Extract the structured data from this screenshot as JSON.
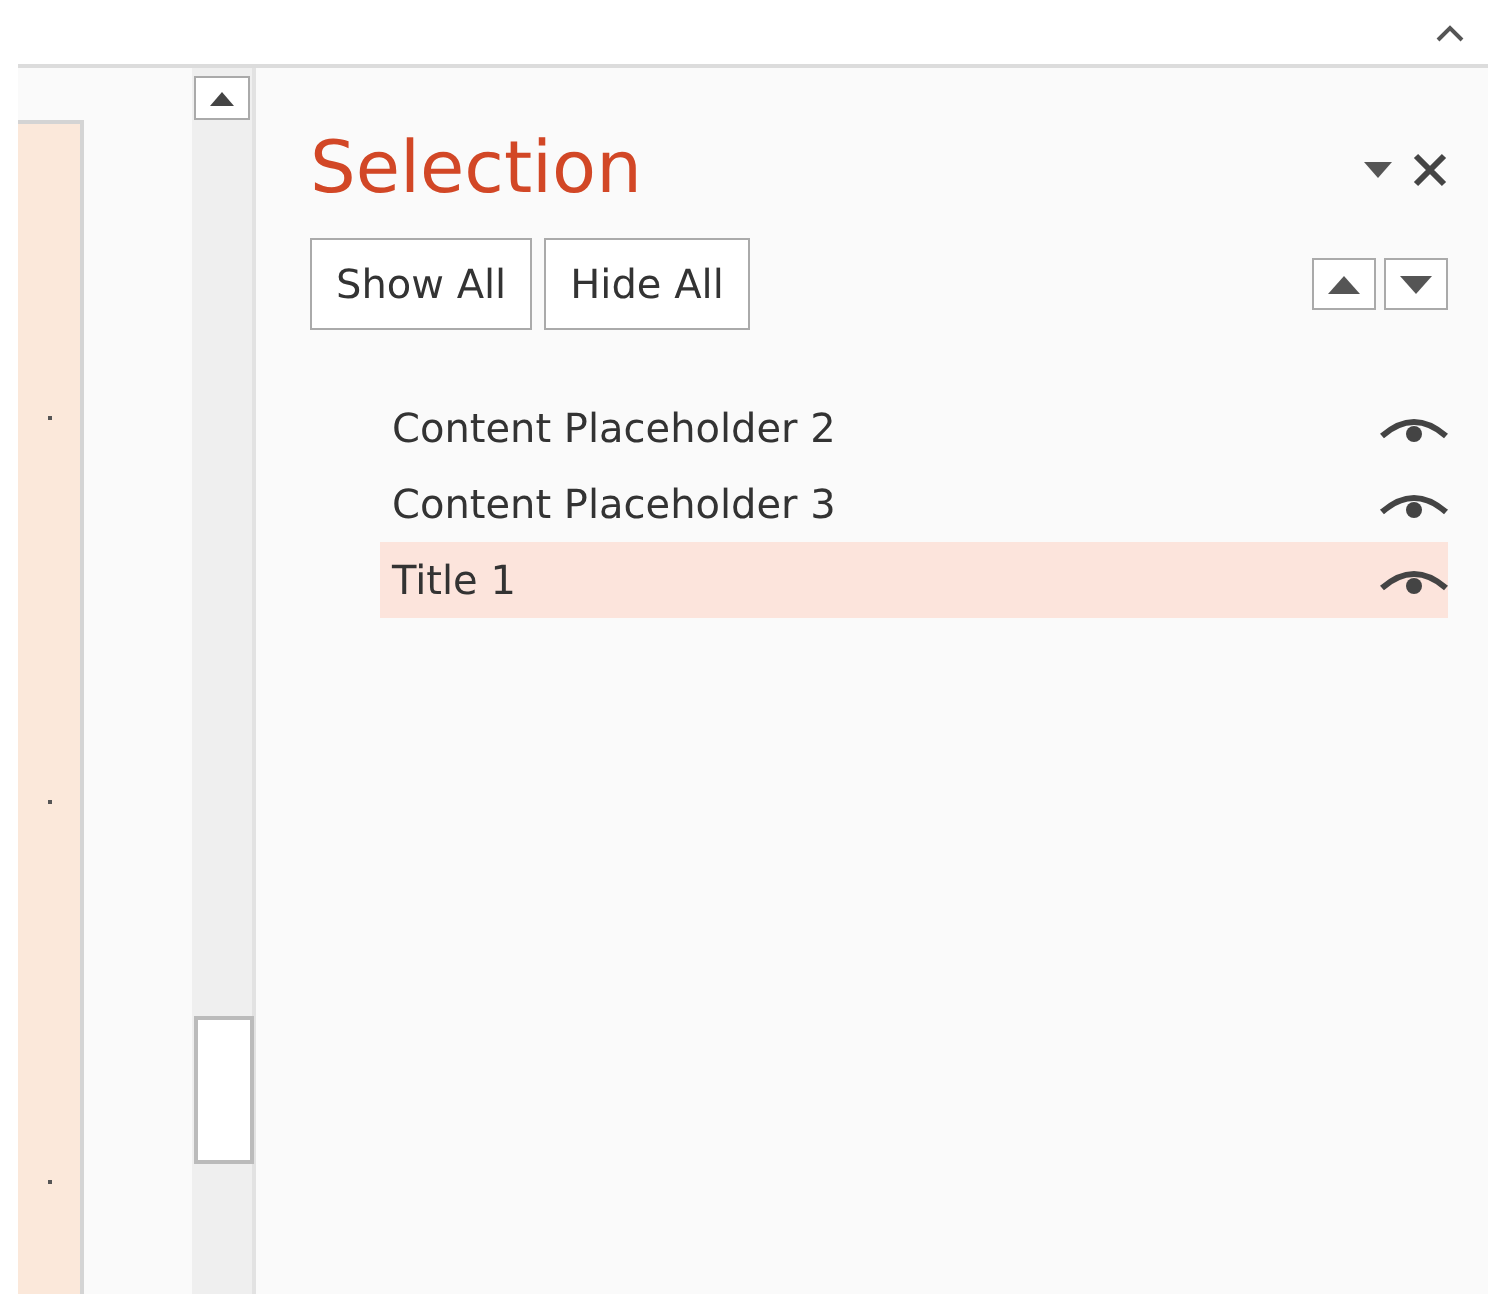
{
  "pane": {
    "title": "Selection"
  },
  "buttons": [
    "Show All",
    "Hide All"
  ],
  "items": [
    {
      "label": "Content Placeholder 2",
      "selected": false
    },
    {
      "label": "Content Placeholder 3",
      "selected": false
    },
    {
      "label": "Title 1",
      "selected": true
    }
  ]
}
